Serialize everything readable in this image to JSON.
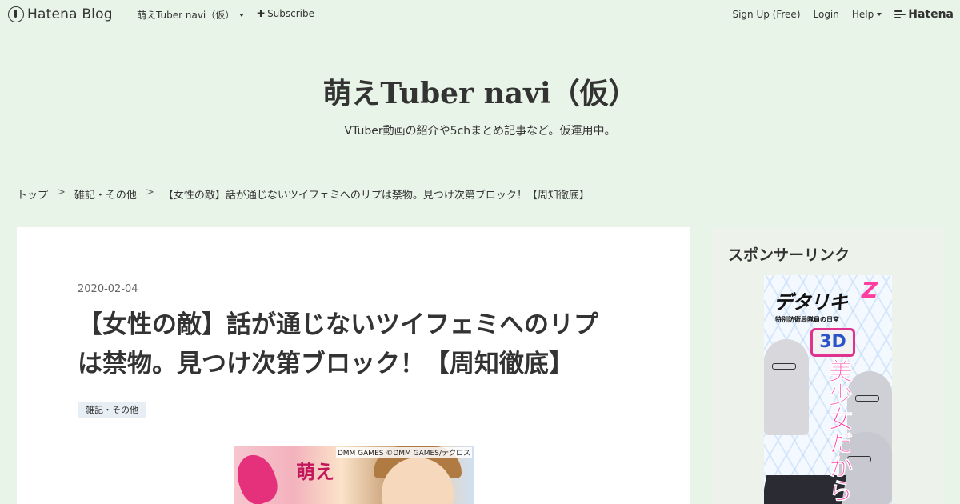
{
  "topbar": {
    "brand": "Hatena Blog",
    "blog_name": "萌えTuber navi（仮）",
    "subscribe": "Subscribe",
    "signup": "Sign Up (Free)",
    "login": "Login",
    "help": "Help",
    "hatena": "Hatena"
  },
  "header": {
    "title": "萌えTuber navi（仮）",
    "description": "VTuber動画の紹介や5chまとめ記事など。仮運用中。"
  },
  "breadcrumb": [
    "トップ",
    "雑記・その他",
    "【女性の敵】話が通じないツイフェミへのリプは禁物。見つけ次第ブロック！【周知徹底】"
  ],
  "breadcrumb_sep": ">",
  "entry": {
    "date": "2020-02-04",
    "title_line1": "【女性の敵】話が通じないツイフェミへのリプ",
    "title_line2": "は禁物。見つけ次第ブロック！【周知徹底】",
    "category": "雑記・その他",
    "image_credit": "DMM GAMES ©DMM GAMES/テクロス",
    "image_text": "萌え"
  },
  "sidebar": {
    "title": "スポンサーリンク",
    "ad": {
      "logo": "デタリキ",
      "logo_suffix": "Z",
      "subtitle": "特別防衛局隊員の日常",
      "badge": "3D",
      "tagline": "美少女だから"
    }
  },
  "colors": {
    "background": "#e9f4e8",
    "card": "#ffffff",
    "sidebar": "#edf3eb",
    "tag": "#e8eff4"
  }
}
